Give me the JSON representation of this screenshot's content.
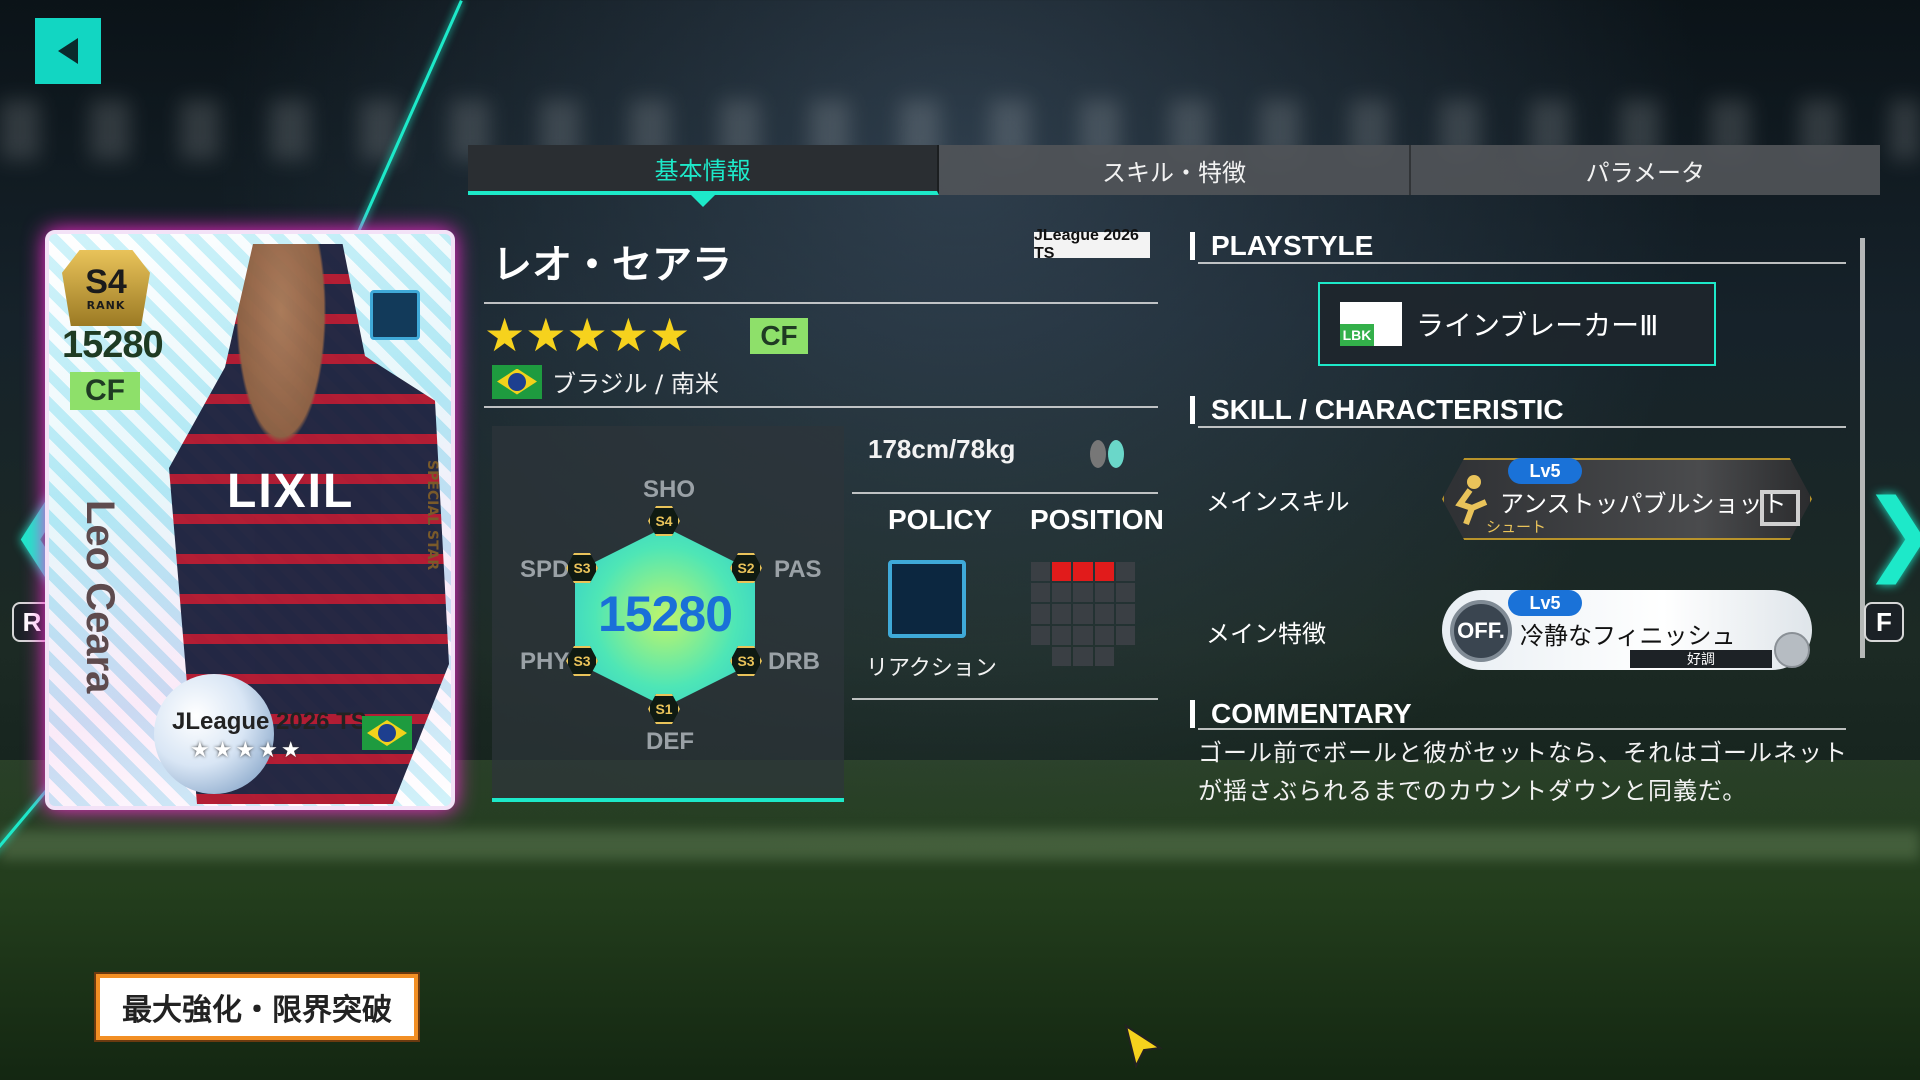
{
  "tabs": [
    {
      "label": "基本情報",
      "active": true
    },
    {
      "label": "スキル・特徴",
      "active": false
    },
    {
      "label": "パラメータ",
      "active": false
    }
  ],
  "card": {
    "rank": "S4",
    "rank_label": "RANK",
    "power": "15280",
    "position": "CF",
    "name": "Leo Ceara",
    "series": "JLeague 2026 TS",
    "special": "SPECIAL STAR",
    "stars": "★★★★★",
    "sponsor": "LIXIL"
  },
  "nav": {
    "left_key": "R",
    "right_key": "F",
    "left_arrow": "❮",
    "right_arrow": "❯"
  },
  "player": {
    "name": "レオ・セアラ",
    "series_badge": "JLeague 2026 TS",
    "stars": "★★★★★",
    "position": "CF",
    "nationality": "ブラジル / 南米",
    "body": "178cm/78kg"
  },
  "stats": {
    "total": "15280",
    "sho": {
      "label": "SHO",
      "grade": "S4"
    },
    "pas": {
      "label": "PAS",
      "grade": "S2"
    },
    "drb": {
      "label": "DRB",
      "grade": "S3"
    },
    "def": {
      "label": "DEF",
      "grade": "S1"
    },
    "phy": {
      "label": "PHY",
      "grade": "S3"
    },
    "spd": {
      "label": "SPD",
      "grade": "S3"
    }
  },
  "policy": {
    "heading": "POLICY",
    "label": "リアクション"
  },
  "position_panel": {
    "heading": "POSITION"
  },
  "playstyle": {
    "heading": "PLAYSTYLE",
    "abbr": "LBK",
    "name": "ラインブレーカーⅢ"
  },
  "skills": {
    "heading": "SKILL / CHARACTERISTIC",
    "main_skill_label": "メインスキル",
    "main_skill_level": "Lv5",
    "main_skill_name": "アンストッパブルショット",
    "main_skill_type": "シュート",
    "main_trait_label": "メイン特徴",
    "main_trait_level": "Lv5",
    "main_trait_name": "冷静なフィニッシュ",
    "main_trait_off": "OFF.",
    "main_trait_mood": "好調"
  },
  "commentary": {
    "heading": "COMMENTARY",
    "text": "ゴール前でボールと彼がセットなら、それはゴールネットが揺さぶられるまでのカウントダウンと同義だ。"
  },
  "buttons": {
    "max": "最大強化・限界突破"
  },
  "colors": {
    "accent": "#1de9c9",
    "position_badge": "#8ee06a",
    "star": "#f6d21d",
    "max_button_border": "#f28f24"
  }
}
